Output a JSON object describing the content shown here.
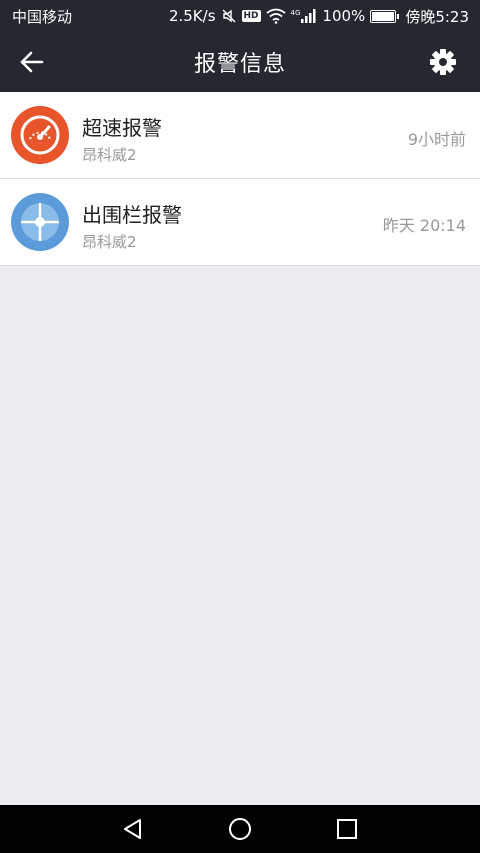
{
  "status_bar": {
    "carrier": "中国移动",
    "net_speed": "2.5K/s",
    "icons": [
      "mute-icon",
      "hd-icon",
      "wifi-icon",
      "signal-4g-icon",
      "battery-icon"
    ],
    "hd_label": "HD",
    "network_label": "4G",
    "battery": "100%",
    "battery_level": 1.0,
    "time": "傍晚5:23"
  },
  "app_bar": {
    "title": "报警信息",
    "back_icon": "arrow-left-icon",
    "settings_icon": "gear-icon"
  },
  "alerts": [
    {
      "title": "超速报警",
      "subtitle": "昂科威2",
      "time": "9小时前",
      "icon": "speedometer-icon",
      "icon_color": "#e8552a"
    },
    {
      "title": "出围栏报警",
      "subtitle": "昂科威2",
      "time": "昨天 20:14",
      "icon": "geofence-icon",
      "icon_color": "#5b9bd9"
    }
  ],
  "nav_bar": {
    "icons": [
      "back-triangle-icon",
      "home-circle-icon",
      "recents-square-icon"
    ]
  },
  "colors": {
    "bar_bg": "#262830",
    "page_bg": "#ecebf0",
    "speed_alert": "#e8552a",
    "fence_alert": "#5b9bd9"
  }
}
